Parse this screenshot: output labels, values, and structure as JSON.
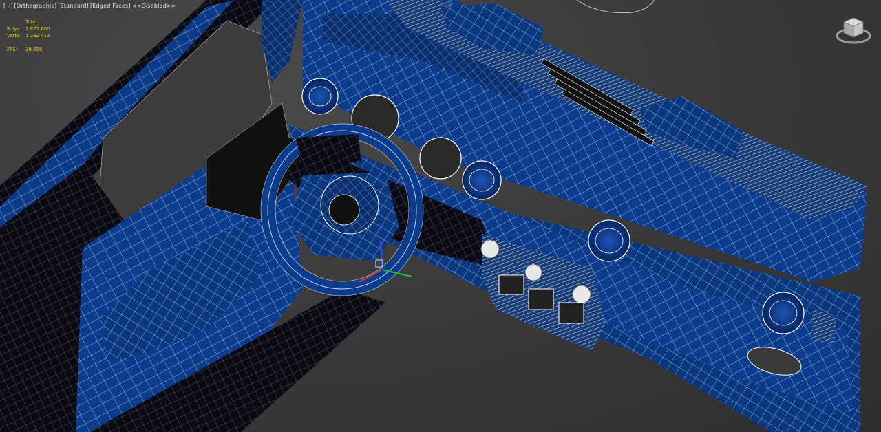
{
  "viewport": {
    "menu": {
      "plus": "[+]",
      "view": "[Orthographic]",
      "shading": "[Standard]",
      "edges": "[Edged Faces]",
      "mode": "<<Disabled>>"
    }
  },
  "stats": {
    "header": "Total",
    "polys_label": "Polys:",
    "polys_value": "1 877 600",
    "verts_label": "Verts:",
    "verts_value": "1 232 413",
    "fps_label": "FPS:",
    "fps_value": "36,656"
  },
  "colors": {
    "mesh": "#0a3a8c",
    "mesh_dark": "#062a66",
    "wire": "#ffffff",
    "background": "#3a3a3a",
    "stats_text": "#e8c400",
    "gizmo_x": "#e03a2a",
    "gizmo_y": "#2ac040",
    "gizmo_z": "#3050ff"
  },
  "icons": {
    "viewcube": "viewcube-icon",
    "gizmo": "transform-gizmo-icon"
  }
}
